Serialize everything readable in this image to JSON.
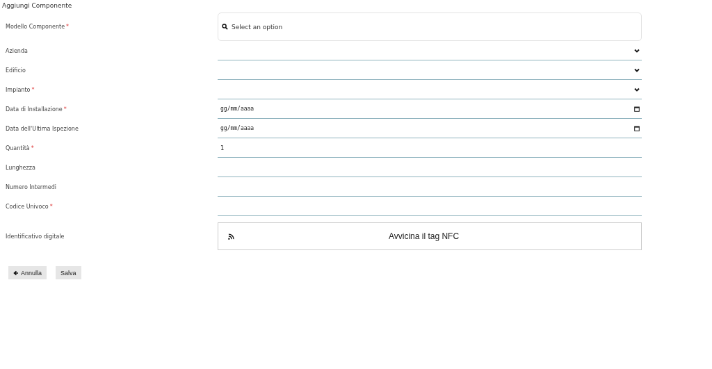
{
  "title": "Aggiungi Componente",
  "fields": [
    {
      "kind": "search",
      "label": "Modello Componente",
      "required_mark": "*",
      "placeholder": "Select an option"
    },
    {
      "kind": "select",
      "label": "Azienda"
    },
    {
      "kind": "select",
      "label": "Edificio"
    },
    {
      "kind": "select",
      "label": "Impianto",
      "required_mark": "*"
    },
    {
      "kind": "date",
      "label": "Data di Installazione",
      "required_mark": "*",
      "value": "gg/mm/aaaa"
    },
    {
      "kind": "date",
      "label": "Data dell'Ultima Ispezione",
      "value": "gg/mm/aaaa"
    },
    {
      "kind": "text",
      "label": "Quantità",
      "required_mark": "*",
      "value": "1"
    },
    {
      "kind": "text",
      "label": "Lunghezza"
    },
    {
      "kind": "text",
      "label": "Numero Intermedi"
    },
    {
      "kind": "text",
      "label": "Codice Univoco",
      "required_mark": "*"
    },
    {
      "kind": "nfc",
      "label": "Identificativo digitale",
      "text": "Avvicina il tag NFC"
    }
  ],
  "buttons": [
    {
      "kind": "back",
      "label": "Annulla"
    },
    {
      "kind": "plain",
      "label": "Salva"
    }
  ]
}
